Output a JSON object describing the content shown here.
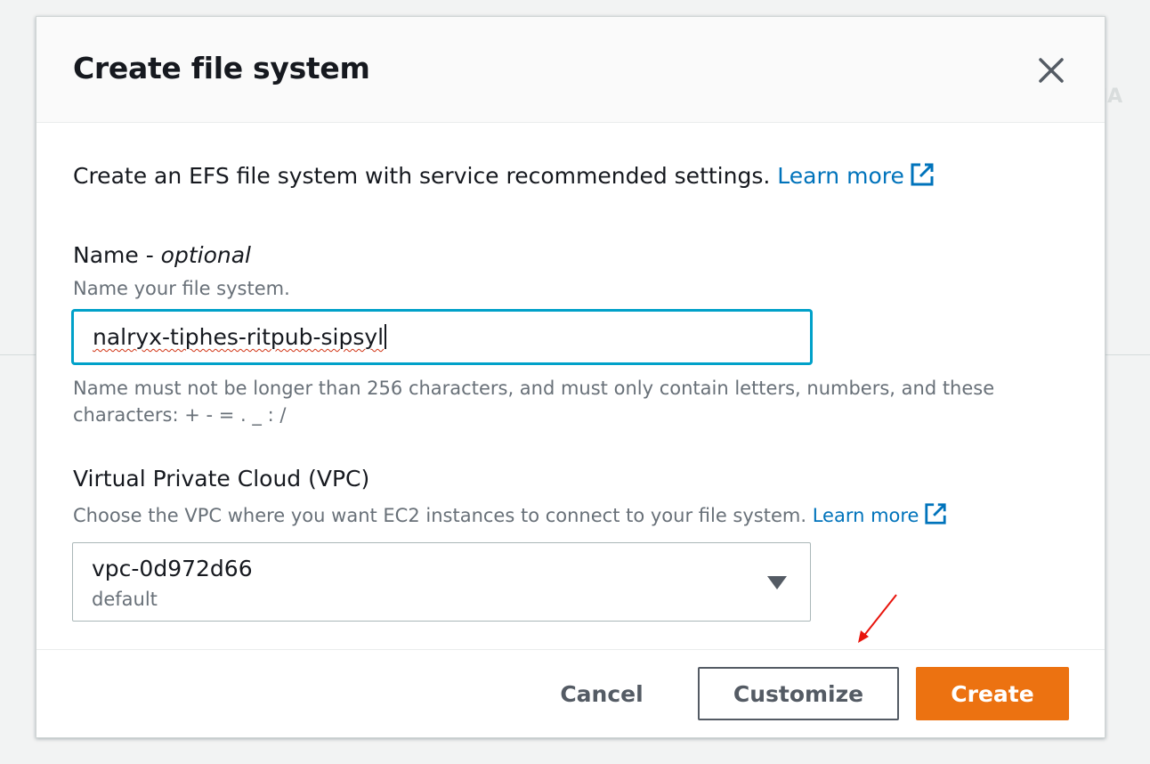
{
  "background": {
    "partial_text": "IA"
  },
  "modal": {
    "title": "Create file system",
    "intro_text": "Create an EFS file system with service recommended settings.",
    "intro_link": "Learn more",
    "name_field": {
      "label": "Name - ",
      "label_optional": "optional",
      "description": "Name your file system.",
      "value": "nalryx-tiphes-ritpub-sipsyl",
      "constraint": "Name must not be longer than 256 characters, and must only contain letters, numbers, and these characters: + - = . _ : /"
    },
    "vpc_field": {
      "label": "Virtual Private Cloud (VPC)",
      "description": "Choose the VPC where you want EC2 instances to connect to your file system.",
      "link": "Learn more",
      "selected_value": "vpc-0d972d66",
      "selected_sub": "default"
    },
    "footer": {
      "cancel_label": "Cancel",
      "customize_label": "Customize",
      "create_label": "Create"
    }
  },
  "colors": {
    "primary_button": "#ec7211",
    "link": "#0073bb",
    "focus_border": "#00a1c9",
    "annotation_arrow": "#e8140c"
  },
  "icons": {
    "close": "close-icon",
    "external_link": "external-link-icon",
    "dropdown": "caret-down-icon"
  }
}
